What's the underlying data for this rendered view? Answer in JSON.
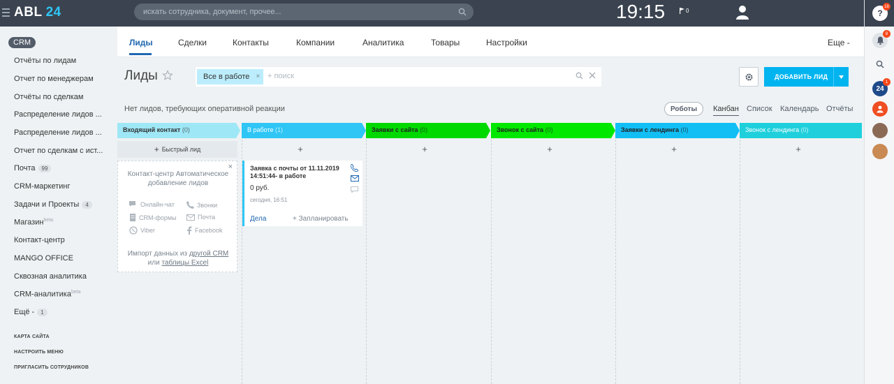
{
  "header": {
    "logo_text": "ABL",
    "logo_num": "24",
    "search_placeholder": "искать сотрудника, документ, прочее...",
    "time": "19:15",
    "flag_count": "0"
  },
  "right_panel": {
    "help_badge": "18",
    "notif_badge": "8",
    "b24_badge": "1"
  },
  "left_menu": {
    "crm_label": "CRM",
    "items": [
      {
        "label": "Отчёты по лидам"
      },
      {
        "label": "Отчет по менеджерам"
      },
      {
        "label": "Отчёты по сделкам"
      },
      {
        "label": "Распределение лидов ..."
      },
      {
        "label": "Распределение лидов ..."
      },
      {
        "label": "Отчет по сделкам с ист..."
      },
      {
        "label": "Почта",
        "count": "99"
      },
      {
        "label": "CRM-маркетинг"
      },
      {
        "label": "Задачи и Проекты",
        "count": "4"
      },
      {
        "label": "Магазин",
        "sup": "beta"
      },
      {
        "label": "Контакт-центр"
      },
      {
        "label": "MANGO OFFICE"
      },
      {
        "label": "Сквозная аналитика"
      },
      {
        "label": "CRM-аналитика",
        "sup": "beta"
      },
      {
        "label": "Ещё -",
        "count": "1"
      }
    ],
    "system": [
      "КАРТА САЙТА",
      "НАСТРОИТЬ МЕНЮ",
      "ПРИГЛАСИТЬ СОТРУДНИКОВ"
    ]
  },
  "nav": {
    "tabs": [
      "Лиды",
      "Сделки",
      "Контакты",
      "Компании",
      "Аналитика",
      "Товары",
      "Настройки"
    ],
    "more": "Еще -"
  },
  "toolbar": {
    "title": "Лиды",
    "filter_chip": "Все в работе",
    "filter_add": "+ поиск",
    "add_button": "ДОБАВИТЬ ЛИД"
  },
  "info": {
    "no_leads": "Нет лидов, требующих оперативной реакции",
    "robots": "Роботы",
    "views": [
      "Канбан",
      "Список",
      "Календарь",
      "Отчёты"
    ]
  },
  "kanban": {
    "stages": [
      {
        "name": "Входящий контакт",
        "count": "(0)",
        "color": "#9ee7f6",
        "text": "#333333"
      },
      {
        "name": "В работе",
        "count": "(1)",
        "color": "#2fc6f6",
        "text": "#ffffff"
      },
      {
        "name": "Заявки с сайта",
        "count": "(0)",
        "color": "#00d900",
        "text": "#222222"
      },
      {
        "name": "Звонок с сайта",
        "count": "(0)",
        "color": "#00e700",
        "text": "#222222"
      },
      {
        "name": "Заявки с лендинга",
        "count": "(0)",
        "color": "#12bff5",
        "text": "#222222"
      },
      {
        "name": "Звонок с лендинга",
        "count": "(0)",
        "color": "#1fd0dc",
        "text": "#ffffff"
      }
    ],
    "quick_lead": "Быстрый лид",
    "add_sign": "+",
    "contact_center": {
      "title": "Контакт-центр Автоматическое добавление лидов",
      "items": [
        "Онлайн-чат",
        "Звонки",
        "CRM-формы",
        "Почта",
        "Viber",
        "Facebook"
      ],
      "import_prefix": "Импорт данных из",
      "import_link1": "другой CRM",
      "import_mid": "или",
      "import_link2": "таблицы Excel"
    },
    "lead_card": {
      "title": "Заявка с почты от 11.11.2019 14:51:44- в работе",
      "sum": "0 руб.",
      "date": "сегодня, 16:51",
      "deals": "Дела",
      "plan": "+ Запланировать"
    }
  }
}
